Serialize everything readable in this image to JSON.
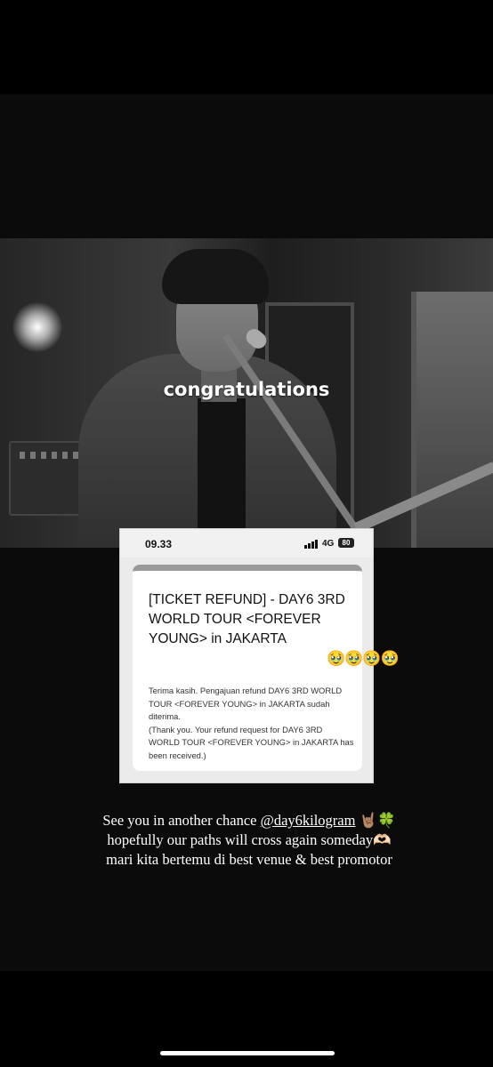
{
  "photo": {
    "caption": "congratulations"
  },
  "screenshot": {
    "status_bar": {
      "time": "09.33",
      "network": "4G",
      "battery": "80"
    },
    "email": {
      "subject": "[TICKET REFUND] - DAY6 3RD WORLD TOUR <FOREVER YOUNG> in JAKARTA",
      "body_id": "Terima kasih. Pengajuan refund DAY6 3RD WORLD TOUR <FOREVER YOUNG> in JAKARTA sudah diterima.",
      "body_en": "(Thank you. Your refund request for DAY6 3RD WORLD TOUR <FOREVER YOUNG> in JAKARTA has been received.)"
    }
  },
  "emojis": "🥹🥹🥹🥹",
  "story_text": {
    "line1_prefix": "See you in another chance ",
    "mention": "@day6kilogram",
    "line1_suffix": " 🤘🏽🍀",
    "line2": "hopefully our paths will cross again  someday🫶🏻",
    "line3": "mari kita bertemu di best venue & best promotor"
  }
}
